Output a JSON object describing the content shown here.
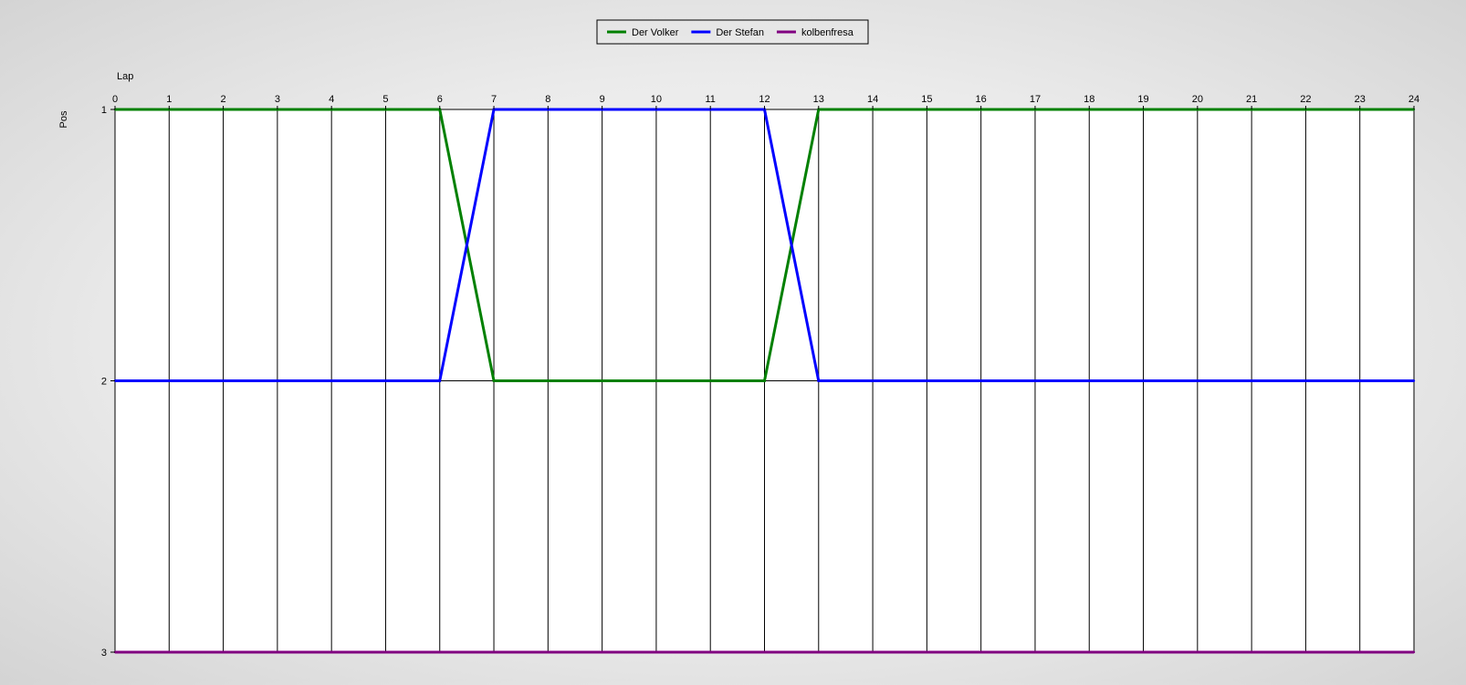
{
  "chart_data": {
    "type": "line",
    "title": "",
    "xlabel": "Lap",
    "ylabel": "Pos",
    "x_axis_position": "top",
    "y_inverted": true,
    "x": [
      0,
      1,
      2,
      3,
      4,
      5,
      6,
      7,
      8,
      9,
      10,
      11,
      12,
      13,
      14,
      15,
      16,
      17,
      18,
      19,
      20,
      21,
      22,
      23,
      24
    ],
    "xlim": [
      0,
      24
    ],
    "ylim": [
      1,
      3
    ],
    "y_ticks": [
      1,
      2,
      3
    ],
    "grid": "vertical",
    "legend_position": "top-center",
    "series": [
      {
        "name": "Der Volker",
        "color": "#008000",
        "values": [
          1,
          1,
          1,
          1,
          1,
          1,
          1,
          2,
          2,
          2,
          2,
          2,
          2,
          1,
          1,
          1,
          1,
          1,
          1,
          1,
          1,
          1,
          1,
          1,
          1
        ]
      },
      {
        "name": "Der Stefan",
        "color": "#0000ff",
        "values": [
          2,
          2,
          2,
          2,
          2,
          2,
          2,
          1,
          1,
          1,
          1,
          1,
          1,
          2,
          2,
          2,
          2,
          2,
          2,
          2,
          2,
          2,
          2,
          2,
          2
        ]
      },
      {
        "name": "kolbenfresa",
        "color": "#800080",
        "values": [
          3,
          3,
          3,
          3,
          3,
          3,
          3,
          3,
          3,
          3,
          3,
          3,
          3,
          3,
          3,
          3,
          3,
          3,
          3,
          3,
          3,
          3,
          3,
          3,
          3
        ]
      }
    ]
  }
}
